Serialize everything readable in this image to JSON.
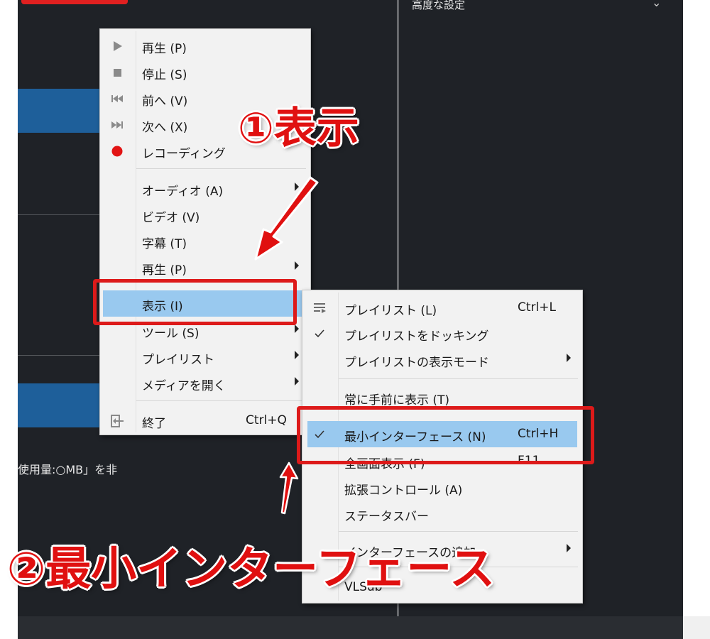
{
  "background": {
    "settings_title": "高度な設定",
    "partial_text": "使用量:○MB」を非"
  },
  "menu": {
    "items": [
      {
        "label": "再生 (P)",
        "icon": "play-icon"
      },
      {
        "label": "停止 (S)",
        "icon": "stop-icon"
      },
      {
        "label": "前へ (V)",
        "icon": "previous-icon"
      },
      {
        "label": "次へ (X)",
        "icon": "next-icon"
      },
      {
        "label": "レコーディング",
        "icon": "record-icon"
      },
      {
        "label": "オーディオ (A)"
      },
      {
        "label": "ビデオ (V)"
      },
      {
        "label": "字幕 (T)"
      },
      {
        "label": "再生 (P)"
      },
      {
        "label": "表示 (I)"
      },
      {
        "label": "ツール (S)"
      },
      {
        "label": "プレイリスト"
      },
      {
        "label": "メディアを開く"
      },
      {
        "label": "終了",
        "shortcut": "Ctrl+Q",
        "icon": "exit-icon"
      }
    ]
  },
  "submenu": {
    "items": [
      {
        "label": "プレイリスト (L)",
        "shortcut": "Ctrl+L",
        "icon": "playlist-icon"
      },
      {
        "label": "プレイリストをドッキング",
        "icon": "checkmark-icon"
      },
      {
        "label": "プレイリストの表示モード"
      },
      {
        "label": "常に手前に表示 (T)"
      },
      {
        "label": "最小インターフェース (N)",
        "shortcut": "Ctrl+H",
        "icon": "checkmark-icon"
      },
      {
        "label": "全画面表示 (F)",
        "shortcut": "F11"
      },
      {
        "label": "拡張コントロール (A)"
      },
      {
        "label": "ステータスバー"
      },
      {
        "label": "インターフェースの追加"
      },
      {
        "label": "VLSub"
      }
    ]
  },
  "annotations": {
    "step1": "①表示",
    "step2": "②最小インターフェース"
  },
  "colors": {
    "highlight": "#99c9ef",
    "annotation_red": "#e01010",
    "dark_bg": "#1f2227"
  }
}
